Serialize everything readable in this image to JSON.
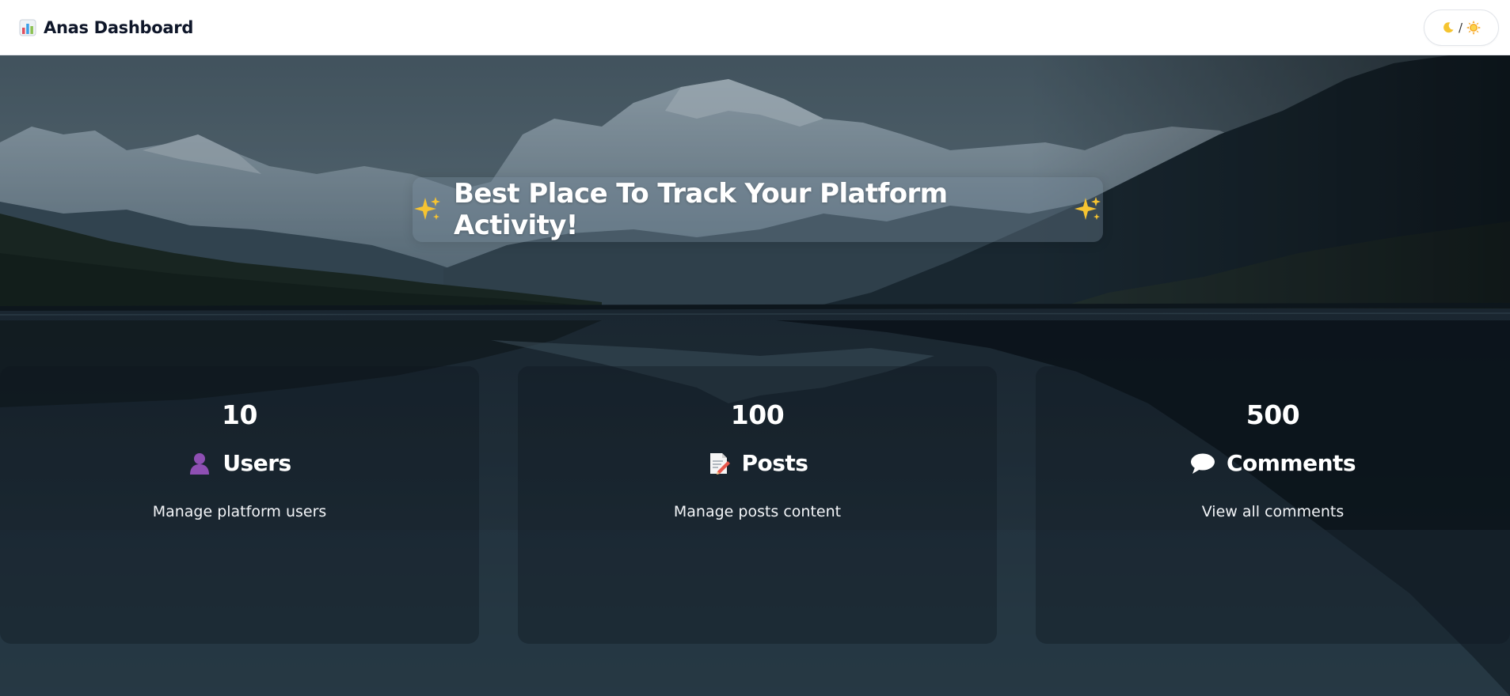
{
  "navbar": {
    "brand_icon": "bar-chart-icon",
    "brand_title": "Anas Dashboard",
    "theme_toggle": {
      "moon_icon": "moon-icon",
      "separator": "/",
      "sun_icon": "sun-icon"
    }
  },
  "hero": {
    "background": "mountain-lake-landscape",
    "headline_icon": "sparkles-icon",
    "headline": "Best Place To Track Your Platform Activity!"
  },
  "cards": [
    {
      "count": "10",
      "icon": "user-silhouette-icon",
      "title": "Users",
      "description": "Manage platform users"
    },
    {
      "count": "100",
      "icon": "memo-icon",
      "title": "Posts",
      "description": "Manage posts content"
    },
    {
      "count": "500",
      "icon": "speech-bubble-icon",
      "title": "Comments",
      "description": "View all comments"
    }
  ],
  "colors": {
    "navbar_bg": "#ffffff",
    "brand_text": "#0f172a",
    "card_bg": "rgba(15,22,30,0.36)",
    "text_on_hero": "#ffffff"
  }
}
